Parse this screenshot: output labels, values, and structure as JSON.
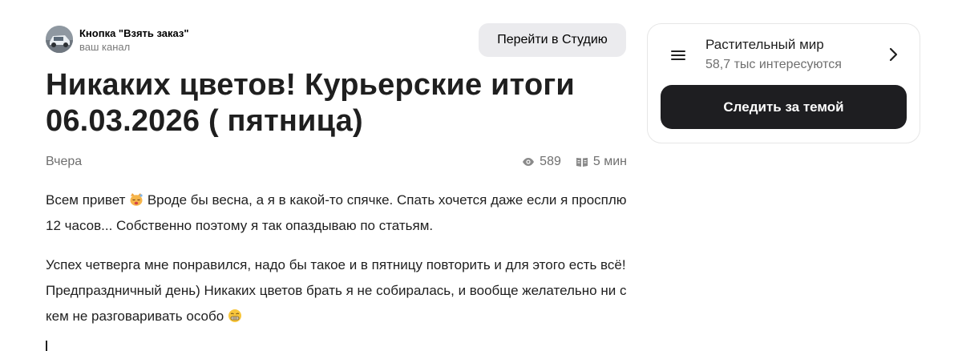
{
  "channel": {
    "name": "Кнопка \"Взять заказ\"",
    "subtitle": "ваш канал",
    "studio_button_label": "Перейти в Студию"
  },
  "article": {
    "title": "Никаких цветов! Курьерские итоги 06.03.2026 ( пятница)",
    "date": "Вчера",
    "views": "589",
    "read_time": "5 мин",
    "paragraphs": [
      {
        "before_emoji": "Всем привет ",
        "emoji": "sleepy-cat-emoji",
        "after_emoji": " Вроде бы весна, а я в какой-то спячке. Спать хочется даже если я просплю 12 часов... Собственно поэтому я так опаздываю по статьям."
      },
      {
        "before_emoji": "Успех четверга мне понравился, надо бы такое и в пятницу повторить и для этого есть всё! Предпраздничный день) Никаких цветов брать я не собиралась, и вообще желательно ни с кем не разговаривать особо ",
        "emoji": "grimacing-face-emoji",
        "after_emoji": ""
      }
    ]
  },
  "topic": {
    "title": "Растительный мир",
    "subtitle": "58,7 тыс интересуются",
    "follow_button_label": "Следить за темой"
  },
  "icons": {
    "menu": "menu-icon",
    "views": "eye-icon",
    "read_time": "book-icon",
    "chevron": "chevron-right-icon"
  },
  "colors": {
    "follow_button_bg": "#1e1e21",
    "studio_button_bg": "#ebebee",
    "muted_text": "#6f6f6f"
  }
}
